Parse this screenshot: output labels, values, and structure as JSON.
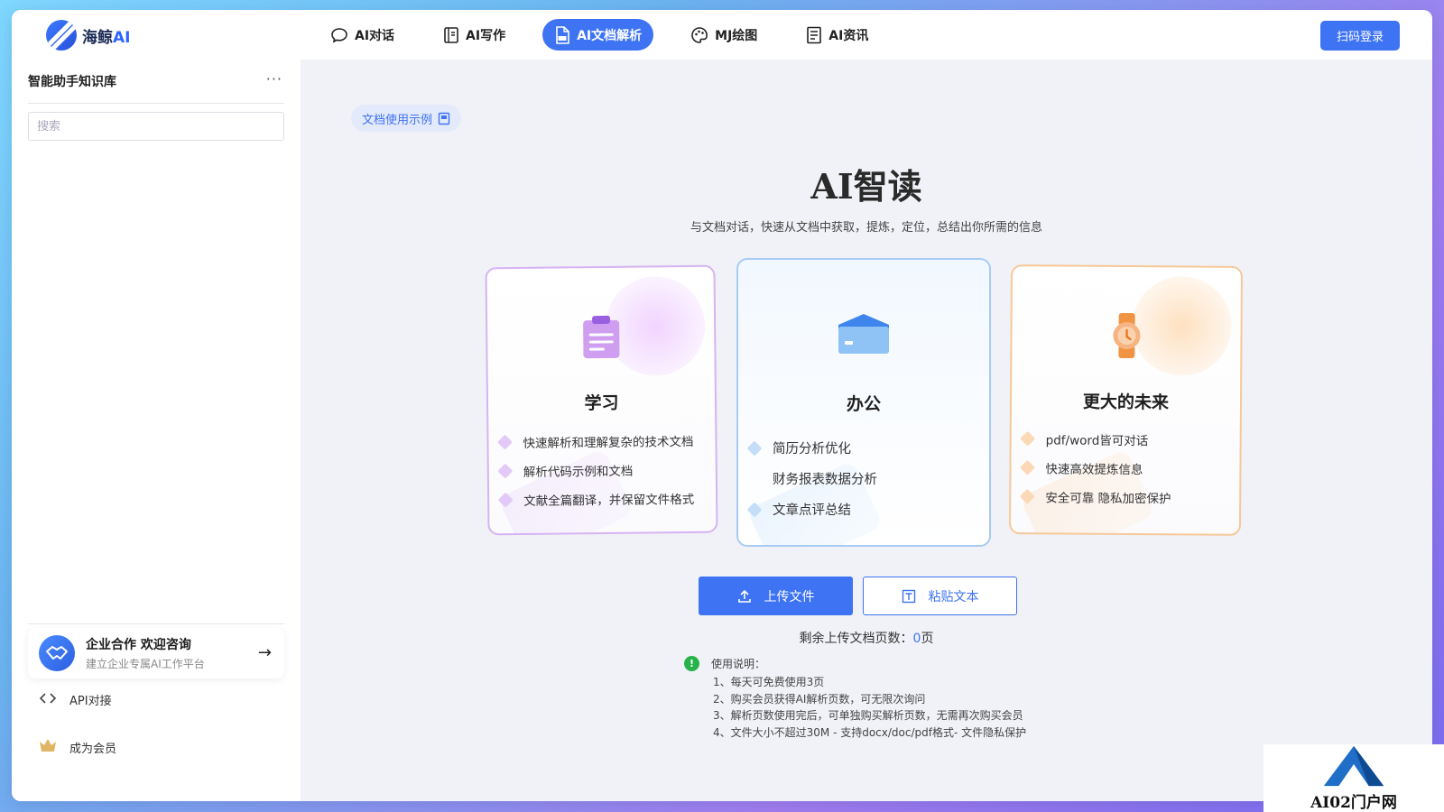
{
  "header": {
    "logo_text": "海鲸",
    "logo_ai": "AI",
    "nav": [
      {
        "label": "AI对话",
        "icon": "chat-icon",
        "active": false
      },
      {
        "label": "AI写作",
        "icon": "notebook-icon",
        "active": false
      },
      {
        "label": "AI文档解析",
        "icon": "pdf-icon",
        "active": true
      },
      {
        "label": "MJ绘图",
        "icon": "palette-icon",
        "active": false
      },
      {
        "label": "AI资讯",
        "icon": "news-icon",
        "active": false
      }
    ],
    "login_label": "扫码登录"
  },
  "sidebar": {
    "title": "智能助手知识库",
    "more": "···",
    "search_placeholder": "搜索",
    "promo_title": "企业合作 欢迎咨询",
    "promo_sub": "建立企业专属AI工作平台",
    "links": [
      {
        "label": "API对接",
        "icon": "api-icon"
      },
      {
        "label": "成为会员",
        "icon": "crown-icon"
      }
    ]
  },
  "main": {
    "example_chip": "文档使用示例",
    "title": "AI智读",
    "subtitle": "与文档对话，快速从文档中获取，提炼，定位，总结出你所需的信息",
    "cards": [
      {
        "title": "学习",
        "items": [
          "快速解析和理解复杂的技术文档",
          "解析代码示例和文档",
          "文献全篇翻译，并保留文件格式"
        ]
      },
      {
        "title": "办公",
        "items": [
          "简历分析优化",
          "财务报表数据分析",
          "文章点评总结"
        ]
      },
      {
        "title": "更大的未来",
        "items": [
          "pdf/word皆可对话",
          "快速高效提炼信息",
          "安全可靠 隐私加密保护"
        ]
      }
    ],
    "upload_label": "上传文件",
    "paste_label": "粘贴文本",
    "remaining_prefix": "剩余上传文档页数：",
    "remaining_num": "0",
    "remaining_unit": "页",
    "notes_title": "使用说明：",
    "notes": [
      "1、每天可免费使用3页",
      "2、购买会员获得AI解析页数，可无限次询问",
      "3、解析页数使用完后，可单独购买解析页数，无需再次购买会员",
      "4、文件大小不超过30M - 支持docx/doc/pdf格式- 文件隐私保护"
    ]
  },
  "watermark": {
    "text": "AI02门户网"
  },
  "colors": {
    "accent": "#3e73f4",
    "success": "#27b24a"
  }
}
